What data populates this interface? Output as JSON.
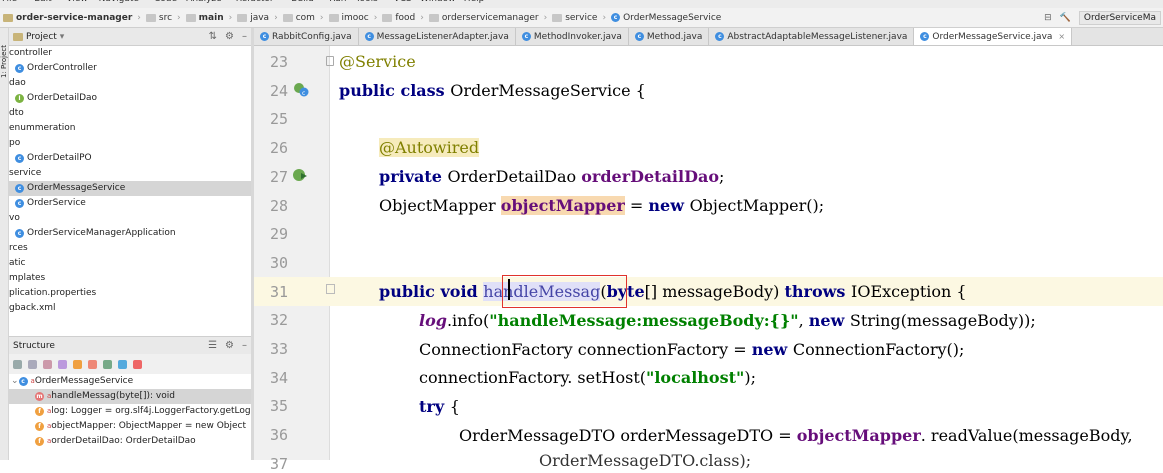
{
  "menu": [
    "File",
    "Edit",
    "View",
    "Navigate",
    "Code",
    "Analyze",
    "Refactor",
    "Build",
    "Run",
    "Tools",
    "VCS",
    "Window",
    "Help"
  ],
  "breadcrumb": {
    "project": "order-service-manager",
    "items": [
      "src",
      "main",
      "java",
      "com",
      "imooc",
      "food",
      "orderservicemanager",
      "service"
    ],
    "file": "OrderMessageService",
    "run_config": "OrderServiceMa"
  },
  "project_panel": {
    "title": "Project",
    "tree": [
      {
        "label": "controller",
        "kind": "folder"
      },
      {
        "label": "OrderController",
        "kind": "class"
      },
      {
        "label": "dao",
        "kind": "folder"
      },
      {
        "label": "OrderDetailDao",
        "kind": "interface"
      },
      {
        "label": "dto",
        "kind": "folder"
      },
      {
        "label": "enummeration",
        "kind": "folder"
      },
      {
        "label": "po",
        "kind": "folder"
      },
      {
        "label": "OrderDetailPO",
        "kind": "class"
      },
      {
        "label": "service",
        "kind": "folder"
      },
      {
        "label": "OrderMessageService",
        "kind": "class",
        "selected": true
      },
      {
        "label": "OrderService",
        "kind": "class"
      },
      {
        "label": "vo",
        "kind": "folder"
      },
      {
        "label": "OrderServiceManagerApplication",
        "kind": "class"
      },
      {
        "label": "rces",
        "kind": "folder"
      },
      {
        "label": "atic",
        "kind": "folder"
      },
      {
        "label": "mplates",
        "kind": "folder"
      },
      {
        "label": "plication.properties",
        "kind": "file"
      },
      {
        "label": "gback.xml",
        "kind": "file"
      }
    ]
  },
  "structure_panel": {
    "title": "Structure",
    "items": [
      {
        "label": "OrderMessageService",
        "kind": "class"
      },
      {
        "label": "handleMessag(byte[]): void",
        "kind": "method",
        "selected": true
      },
      {
        "label": "log: Logger = org.slf4j.LoggerFactory.getLog",
        "kind": "static-field"
      },
      {
        "label": "objectMapper: ObjectMapper = new Object",
        "kind": "field"
      },
      {
        "label": "orderDetailDao: OrderDetailDao",
        "kind": "field"
      }
    ]
  },
  "tabs": [
    {
      "label": "RabbitConfig.java"
    },
    {
      "label": "MessageListenerAdapter.java"
    },
    {
      "label": "MethodInvoker.java"
    },
    {
      "label": "Method.java"
    },
    {
      "label": "AbstractAdaptableMessageListener.java"
    },
    {
      "label": "OrderMessageService.java",
      "active": true
    }
  ],
  "code": {
    "line_numbers": [
      "23",
      "24",
      "25",
      "26",
      "27",
      "28",
      "29",
      "30",
      "31",
      "32",
      "33",
      "34",
      "35",
      "36",
      "37"
    ],
    "l23": "@Service",
    "l24_kw": "public class ",
    "l24_rest": "OrderMessageService {",
    "l26": "@Autowired",
    "l27_kw": "private ",
    "l27_type": "OrderDetailDao ",
    "l27_field": "orderDetailDao",
    "l27_end": ";",
    "l28_type": "ObjectMapper ",
    "l28_field": "objectMapper",
    "l28_eq": " = ",
    "l28_kw": "new ",
    "l28_end": "ObjectMapper();",
    "l31_kw": "public void ",
    "l31_method": "handleMessag",
    "l31_paren": "(",
    "l31_kw2": "byte",
    "l31_params": "[] messageBody) ",
    "l31_kw3": "throws ",
    "l31_end": "IOException {",
    "l32_log": "log",
    "l32_mid": ".info(",
    "l32_str": "\"handleMessage:messageBody:{}\"",
    "l32_comma": ", ",
    "l32_kw": "new ",
    "l32_end": "String(messageBody));",
    "l33_a": "ConnectionFactory connectionFactory = ",
    "l33_kw": "new ",
    "l33_b": "ConnectionFactory();",
    "l34_a": "connectionFactory. setHost(",
    "l34_str": "\"localhost\"",
    "l34_b": ");",
    "l35_kw": "try ",
    "l35_b": "{",
    "l36_a": "OrderMessageDTO orderMessageDTO = ",
    "l36_field": "objectMapper",
    "l36_b": ". readValue(messageBody,",
    "l37": "OrderMessageDTO.class);"
  }
}
